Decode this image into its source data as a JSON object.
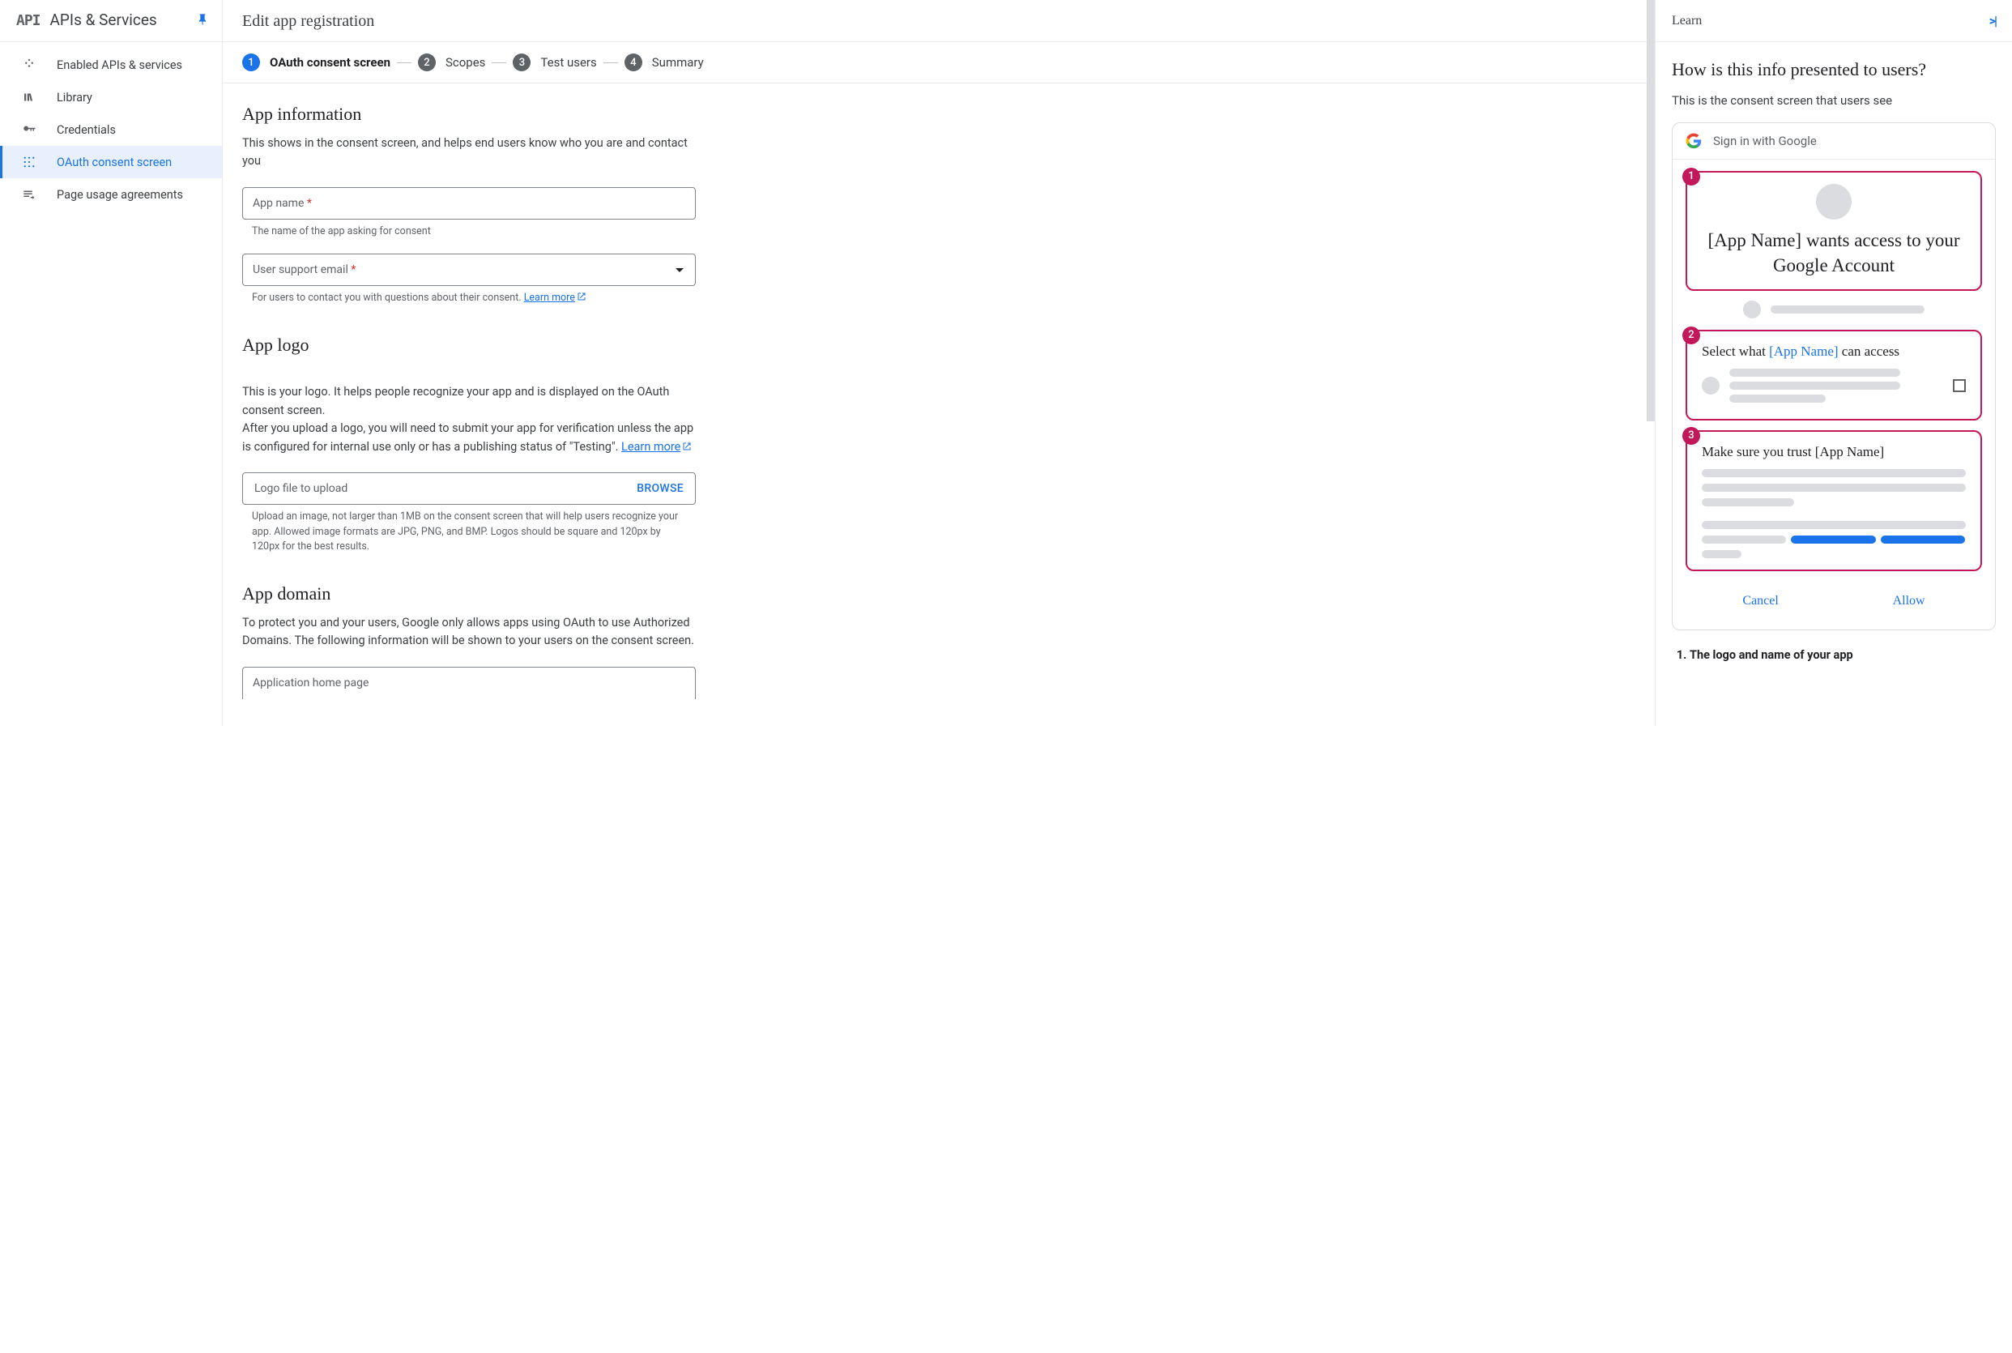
{
  "sidebar": {
    "logo_text": "API",
    "title": "APIs & Services",
    "items": [
      {
        "icon": "grid",
        "label": "Enabled APIs & services"
      },
      {
        "icon": "library",
        "label": "Library"
      },
      {
        "icon": "key",
        "label": "Credentials"
      },
      {
        "icon": "consent",
        "label": "OAuth consent screen"
      },
      {
        "icon": "usage",
        "label": "Page usage agreements"
      }
    ]
  },
  "main": {
    "title": "Edit app registration",
    "steps": [
      {
        "num": "1",
        "label": "OAuth consent screen",
        "active": true
      },
      {
        "num": "2",
        "label": "Scopes"
      },
      {
        "num": "3",
        "label": "Test users"
      },
      {
        "num": "4",
        "label": "Summary"
      }
    ],
    "sections": {
      "app_info": {
        "title": "App information",
        "desc": "This shows in the consent screen, and helps end users know who you are and contact you",
        "app_name_label": "App name",
        "app_name_helper": "The name of the app asking for consent",
        "support_email_label": "User support email",
        "support_email_helper_pre": "For users to contact you with questions about their consent. ",
        "support_email_link": "Learn more"
      },
      "app_logo": {
        "title": "App logo",
        "desc_pre": "This is your logo. It helps people recognize your app and is displayed on the OAuth consent screen.\nAfter you upload a logo, you will need to submit your app for verification unless the app is configured for internal use only or has a publishing status of \"Testing\". ",
        "desc_link": "Learn more",
        "upload_label": "Logo file to upload",
        "browse": "BROWSE",
        "helper": "Upload an image, not larger than 1MB on the consent screen that will help users recognize your app. Allowed image formats are JPG, PNG, and BMP. Logos should be square and 120px by 120px for the best results."
      },
      "app_domain": {
        "title": "App domain",
        "desc": "To protect you and your users, Google only allows apps using OAuth to use Authorized Domains. The following information will be shown to your users on the consent screen.",
        "home_page_label": "Application home page"
      }
    }
  },
  "learn": {
    "title": "Learn",
    "heading": "How is this info presented to users?",
    "sub": "This is the consent screen that users see",
    "mock": {
      "signin": "Sign in with Google",
      "box1": "[App Name] wants access to your Google Account",
      "box2_pre": "Select what ",
      "box2_app": "[App Name]",
      "box2_post": " can access",
      "box3": "Make sure you trust [App Name]",
      "cancel": "Cancel",
      "allow": "Allow"
    },
    "list_item_1": "The logo and name of your app"
  }
}
